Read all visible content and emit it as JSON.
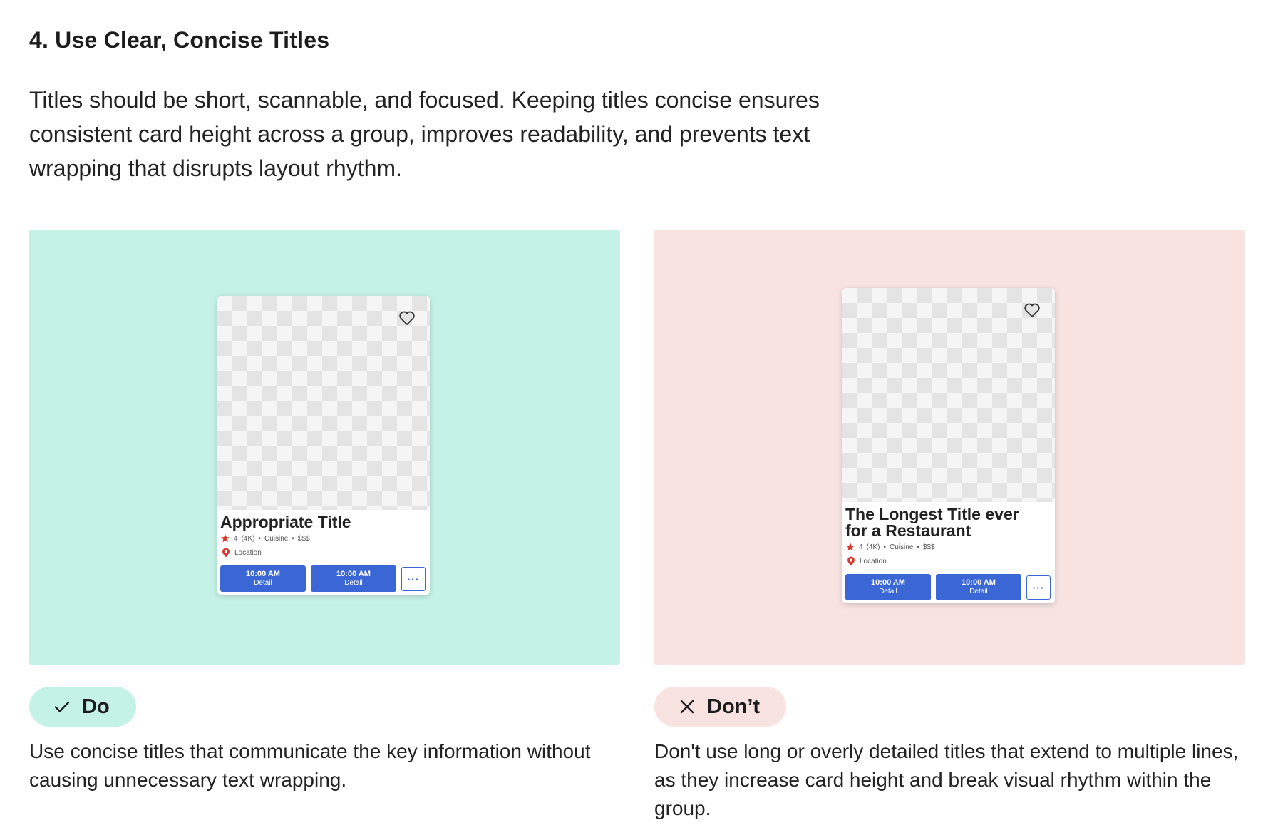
{
  "heading": "4. Use Clear, Concise Titles",
  "intro": "Titles should be short, scannable, and focused. Keeping titles concise ensures consistent card height across a group, improves readability, and prevents text wrapping that disrupts layout rhythm.",
  "colors": {
    "do_bg": "#c5f2e6",
    "dont_bg": "#f8e3e1",
    "button_blue": "#3a66d6",
    "star_red": "#d63a2f"
  },
  "do_example": {
    "card": {
      "title": "Appropriate Title",
      "rating": "4",
      "reviews": "(4K)",
      "cuisine": "Cuisine",
      "price": "$$$",
      "location": "Location",
      "slots": [
        {
          "time": "10:00 AM",
          "label": "Detail"
        },
        {
          "time": "10:00 AM",
          "label": "Detail"
        }
      ],
      "more": "···"
    },
    "badge": "Do",
    "caption": "Use concise titles that communicate the key information without causing unnecessary text wrapping."
  },
  "dont_example": {
    "card": {
      "title_line1": "The Longest Title ever",
      "title_line2": "for a Restaurant",
      "rating": "4",
      "reviews": "(4K)",
      "cuisine": "Cuisine",
      "price": "$$$",
      "location": "Location",
      "slots": [
        {
          "time": "10:00 AM",
          "label": "Detail"
        },
        {
          "time": "10:00 AM",
          "label": "Detail"
        }
      ],
      "more": "···"
    },
    "badge": "Don’t",
    "caption": "Don't use long or overly detailed titles that extend to multiple lines, as they increase card height and break visual rhythm within the group."
  }
}
